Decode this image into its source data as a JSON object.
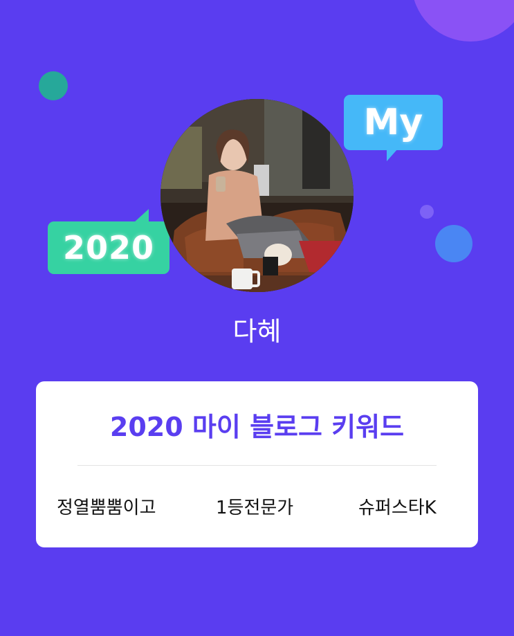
{
  "badges": {
    "year_label": "2020",
    "my_label": "My"
  },
  "profile": {
    "nickname": "다혜"
  },
  "card": {
    "title": "2020 마이 블로그 키워드",
    "keywords": [
      "정열뿜뿜이고",
      "1등전문가",
      "슈퍼스타K"
    ]
  },
  "colors": {
    "background": "#5a3df0",
    "title": "#5a3ef0",
    "badge_2020": "#36d2a2",
    "badge_my": "#45b8f8"
  }
}
